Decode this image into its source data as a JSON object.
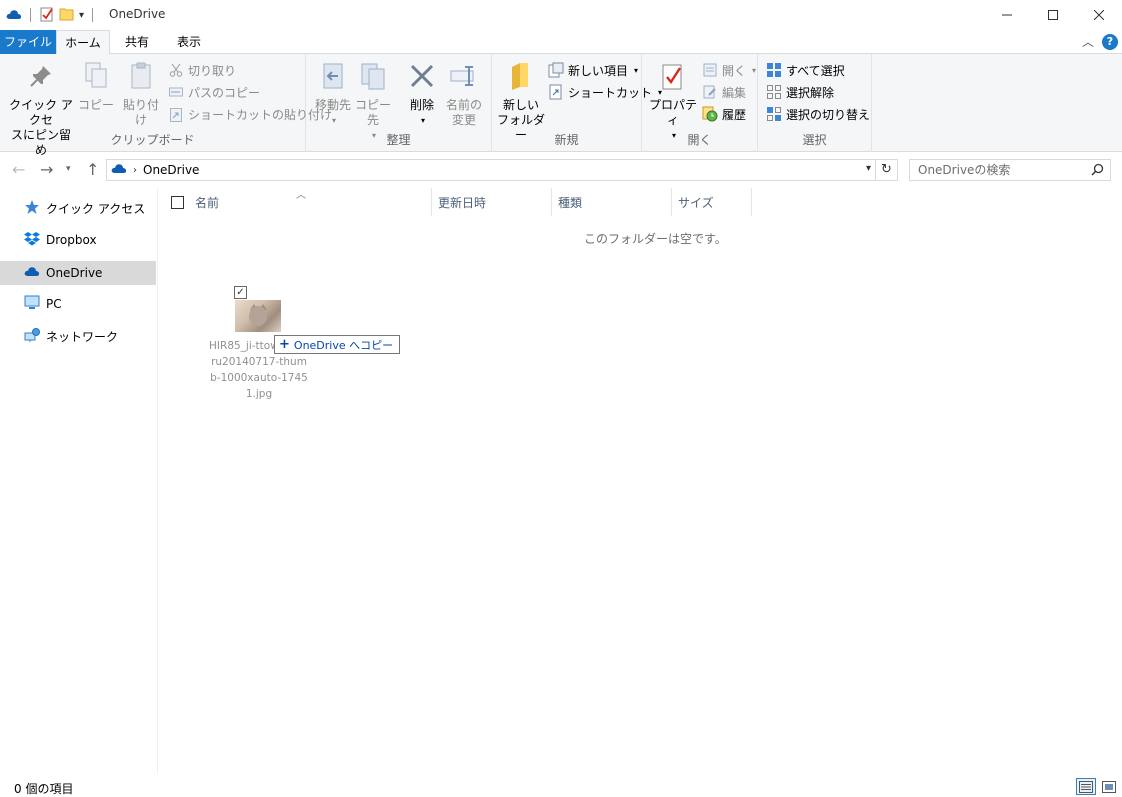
{
  "window": {
    "title": "OneDrive"
  },
  "tabs": {
    "file": "ファイル",
    "home": "ホーム",
    "share": "共有",
    "view": "表示"
  },
  "ribbon": {
    "clipboard": {
      "label": "クリップボード",
      "pin_line1": "クイック アクセ",
      "pin_line2": "スにピン留め",
      "copy": "コピー",
      "paste": "貼り付け",
      "cut": "切り取り",
      "copy_path": "パスのコピー",
      "paste_shortcut": "ショートカットの貼り付け"
    },
    "organize": {
      "label": "整理",
      "move_to": "移動先",
      "copy_to": "コピー先",
      "delete": "削除",
      "rename_line1": "名前の",
      "rename_line2": "変更"
    },
    "new": {
      "label": "新規",
      "new_folder_line1": "新しい",
      "new_folder_line2": "フォルダー",
      "new_item": "新しい項目",
      "shortcut": "ショートカット"
    },
    "open": {
      "label": "開く",
      "properties": "プロパティ",
      "open": "開く",
      "edit": "編集",
      "history": "履歴"
    },
    "select": {
      "label": "選択",
      "select_all": "すべて選択",
      "select_none": "選択解除",
      "invert": "選択の切り替え"
    }
  },
  "address": {
    "location": "OneDrive"
  },
  "search": {
    "placeholder": "OneDriveの検索"
  },
  "navpane": {
    "items": [
      {
        "label": "クイック アクセス"
      },
      {
        "label": "Dropbox"
      },
      {
        "label": "OneDrive"
      },
      {
        "label": "PC"
      },
      {
        "label": "ネットワーク"
      }
    ]
  },
  "columns": {
    "name": "名前",
    "modified": "更新日時",
    "type": "種類",
    "size": "サイズ"
  },
  "content": {
    "empty_message": "このフォルダーは空です。"
  },
  "drag": {
    "filename": "HIR85_ji-ttowomiteru20140717-thumb-1000xauto-17451.jpg",
    "tooltip": "OneDrive へコピー"
  },
  "status": {
    "item_count": "0 個の項目"
  },
  "colors": {
    "accent": "#1979ca",
    "selected_nav": "#d9d9d9",
    "ribbon_bg": "#f5f6f7"
  }
}
